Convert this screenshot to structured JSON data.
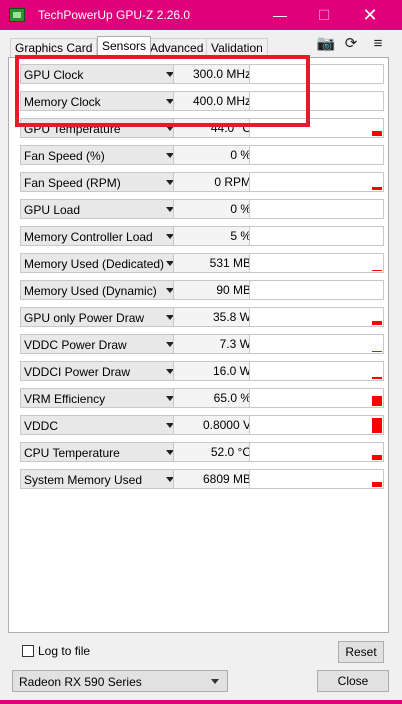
{
  "window": {
    "title": "TechPowerUp GPU-Z 2.26.0",
    "minimize": "—",
    "maximize": "☐",
    "close": "✕"
  },
  "tabs": [
    {
      "label": "Graphics Card",
      "active": false
    },
    {
      "label": "Sensors",
      "active": true
    },
    {
      "label": "Advanced",
      "active": false
    },
    {
      "label": "Validation",
      "active": false
    }
  ],
  "toolbar": {
    "camera": "📷",
    "refresh": "⟳",
    "menu": "≡"
  },
  "sensors": [
    {
      "label": "GPU Clock",
      "value": "300.0 MHz",
      "graph_level": 0
    },
    {
      "label": "Memory Clock",
      "value": "400.0 MHz",
      "graph_level": 0
    },
    {
      "label": "GPU Temperature",
      "value": "44.0 °C",
      "graph_level": 0.25
    },
    {
      "label": "Fan Speed (%)",
      "value": "0 %",
      "graph_level": 0
    },
    {
      "label": "Fan Speed (RPM)",
      "value": "0 RPM",
      "graph_level": 0.15
    },
    {
      "label": "GPU Load",
      "value": "0 %",
      "graph_level": 0
    },
    {
      "label": "Memory Controller Load",
      "value": "5 %",
      "graph_level": 0
    },
    {
      "label": "Memory Used (Dedicated)",
      "value": "531 MB",
      "graph_level": 0.05
    },
    {
      "label": "Memory Used (Dynamic)",
      "value": "90 MB",
      "graph_level": 0
    },
    {
      "label": "GPU only Power Draw",
      "value": "35.8 W",
      "graph_level": 0.2
    },
    {
      "label": "VDDC Power Draw",
      "value": "7.3 W",
      "graph_level": 0.05
    },
    {
      "label": "VDDCI Power Draw",
      "value": "16.0 W",
      "graph_level": 0.1
    },
    {
      "label": "VRM Efficiency",
      "value": "65.0 %",
      "graph_level": 0.55
    },
    {
      "label": "VDDC",
      "value": "0.8000 V",
      "graph_level": 0.85
    },
    {
      "label": "CPU Temperature",
      "value": "52.0 °C",
      "graph_level": 0.3
    },
    {
      "label": "System Memory Used",
      "value": "6809 MB",
      "graph_level": 0.3
    }
  ],
  "footer": {
    "log_label": "Log to file",
    "reset_label": "Reset",
    "gpu_select": "Radeon RX 590 Series",
    "close_label": "Close"
  },
  "colors": {
    "titlebar": "#e0007a",
    "graph_bar": "#ff0000",
    "highlight": "#e11d2c"
  }
}
